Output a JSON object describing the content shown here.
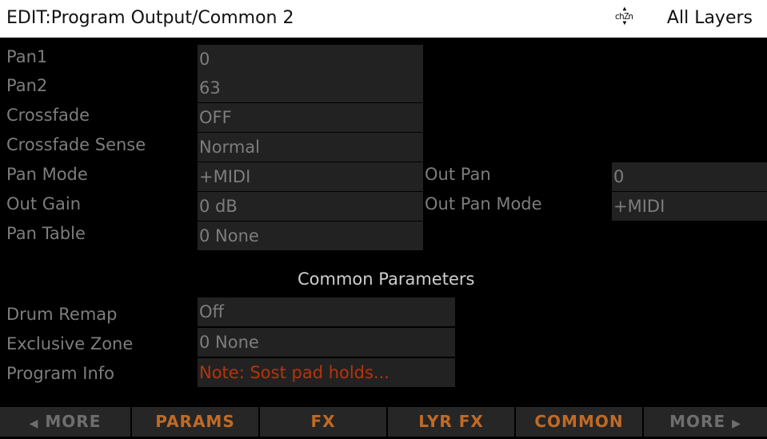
{
  "header": {
    "title": "EDIT:Program Output/Common 2",
    "chan_indicator": "ch",
    "chan_indicator_zn": "Zn",
    "layers": "All Layers"
  },
  "params": [
    {
      "label": "Pan1",
      "value": "0"
    },
    {
      "label": "Pan2",
      "value": "63"
    },
    {
      "label": "Crossfade",
      "value": "OFF"
    },
    {
      "label": "Crossfade Sense",
      "value": "Normal"
    },
    {
      "label": "Pan Mode",
      "value": "+MIDI"
    },
    {
      "label": "Out Gain",
      "value": "0 dB"
    },
    {
      "label": "Pan Table",
      "value": "0 None"
    }
  ],
  "right_params": [
    {
      "label": "Out Pan",
      "value": "0"
    },
    {
      "label": "Out Pan Mode",
      "value": "+MIDI"
    }
  ],
  "section_title": "Common Parameters",
  "common_params": [
    {
      "label": "Drum Remap",
      "value": "Off"
    },
    {
      "label": "Exclusive Zone",
      "value": "0 None"
    },
    {
      "label": "Program Info",
      "value": "Note: Sost pad holds..."
    }
  ],
  "softbuttons": [
    {
      "label": "MORE",
      "arrow": "◀"
    },
    {
      "label": "PARAMS"
    },
    {
      "label": "FX"
    },
    {
      "label": "LYR FX"
    },
    {
      "label": "COMMON"
    },
    {
      "label": "MORE",
      "arrow": "▶"
    }
  ],
  "colors": {
    "header_bg": "#ffffff",
    "field_bg": "#222222",
    "label_text": "#7d7d7d",
    "accent": "#c06a25",
    "info_text": "#b8330a"
  }
}
